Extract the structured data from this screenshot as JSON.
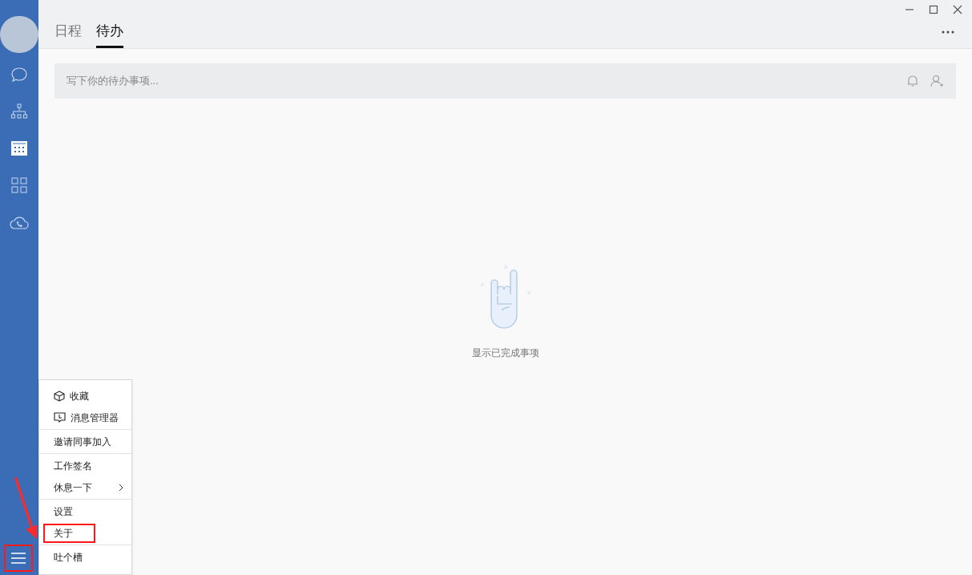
{
  "sidebar": {
    "items": [
      {
        "kind": "chat",
        "selected": false
      },
      {
        "kind": "org",
        "selected": false
      },
      {
        "kind": "calendar",
        "selected": true
      },
      {
        "kind": "apps",
        "selected": false
      },
      {
        "kind": "cloud",
        "selected": false
      }
    ]
  },
  "tabs": [
    {
      "label": "日程",
      "selected": false
    },
    {
      "label": "待办",
      "selected": true
    }
  ],
  "todo_input": {
    "placeholder": "写下你的待办事项..."
  },
  "empty_state": {
    "text": "显示已完成事项"
  },
  "menu": {
    "groups": [
      [
        {
          "label": "收藏",
          "submenu": false,
          "highlighted": false
        },
        {
          "label": "消息管理器",
          "submenu": false,
          "highlighted": false
        }
      ],
      [
        {
          "label": "邀请同事加入",
          "submenu": false,
          "highlighted": false
        }
      ],
      [
        {
          "label": "工作签名",
          "submenu": false,
          "highlighted": false
        },
        {
          "label": "休息一下",
          "submenu": true,
          "highlighted": false
        }
      ],
      [
        {
          "label": "设置",
          "submenu": false,
          "highlighted": false
        },
        {
          "label": "关于",
          "submenu": false,
          "highlighted": true
        }
      ],
      [
        {
          "label": "吐个槽",
          "submenu": false,
          "highlighted": false
        }
      ]
    ]
  }
}
